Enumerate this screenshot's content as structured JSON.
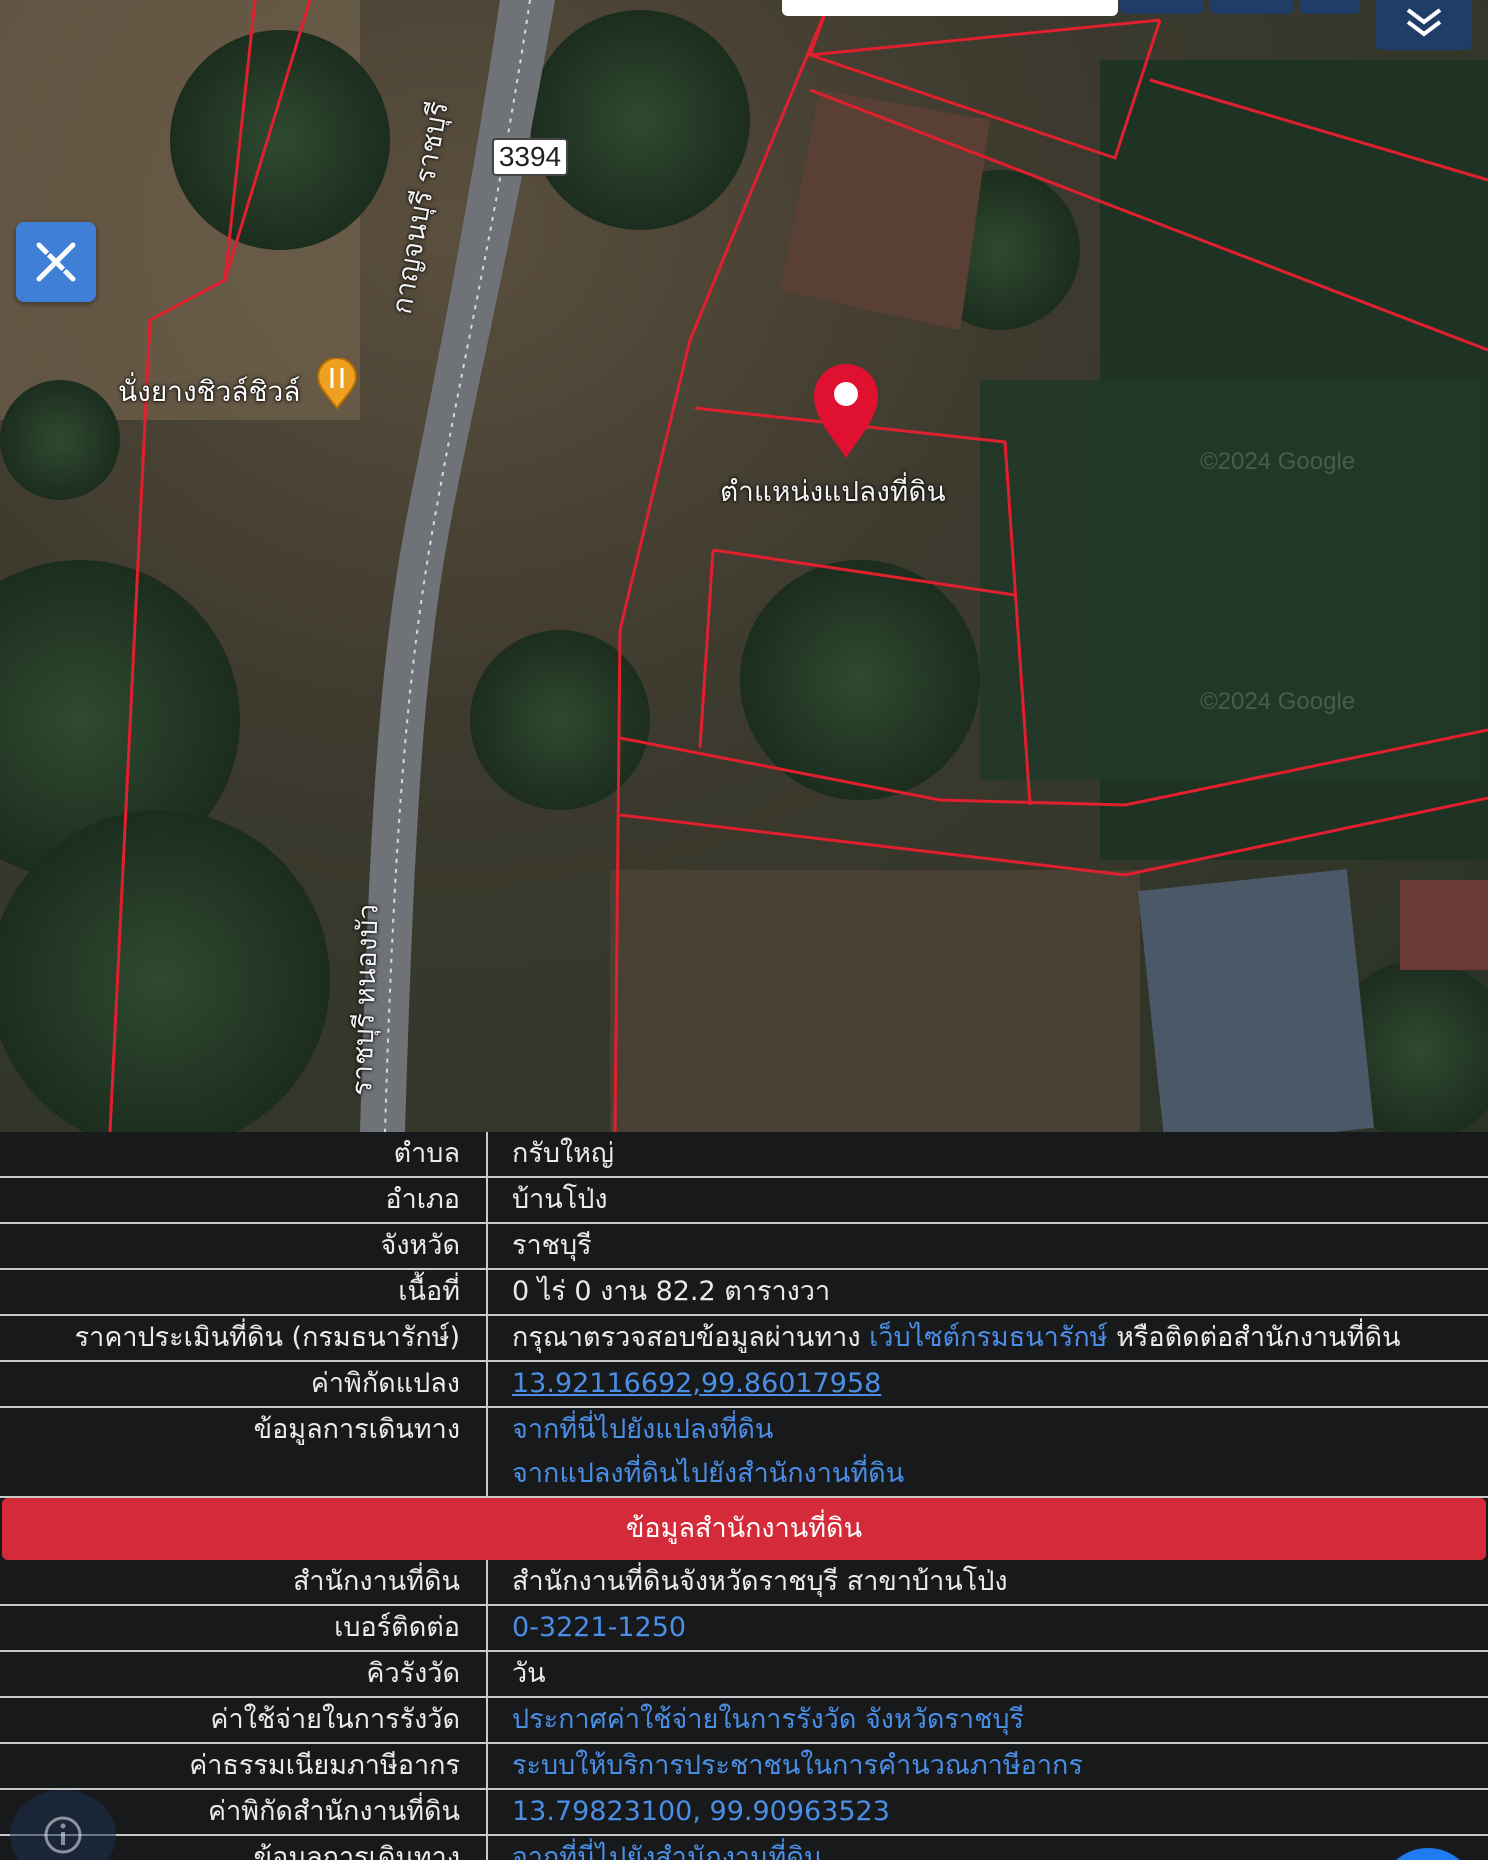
{
  "map": {
    "road_number": "3394",
    "road_name_top": "กาญจนบุรี ราชบุรี",
    "road_name_bottom": "ราชบุรี หนองบัว",
    "poi_name": "นั่งยางชิวล์ชิวล์",
    "pin_label": "ตำแหน่งแปลงที่ดิน",
    "watermark": "©2024 Google"
  },
  "icons": {
    "draw": "draw-ruler-pencil-icon",
    "layers": "layers-chevron-icon",
    "poi": "restaurant-icon",
    "pin": "map-pin-icon",
    "info": "info-icon"
  },
  "colors": {
    "parcel_line": "#e0202e",
    "section_header": "#d42a3a",
    "link": "#4a8ee6",
    "accent": "#3f7fd6"
  },
  "land": {
    "rows": [
      {
        "key": "ตำบล",
        "value": "กรับใหญ่"
      },
      {
        "key": "อำเภอ",
        "value": "บ้านโป่ง"
      },
      {
        "key": "จังหวัด",
        "value": "ราชบุรี"
      },
      {
        "key": "เนื้อที่",
        "value": "0 ไร่ 0 งาน 82.2 ตารางวา"
      }
    ],
    "price_key": "ราคาประเมินที่ดิน (กรมธนารักษ์)",
    "price_pre": "กรุณาตรวจสอบข้อมูลผ่านทาง",
    "price_link": "เว็บไซต์กรมธนารักษ์",
    "price_post": "หรือติดต่อสำนักงานที่ดิน",
    "coord_key": "ค่าพิกัดแปลง",
    "coord_value": "13.92116692,99.86017958",
    "travel_key": "ข้อมูลการเดินทาง",
    "travel_link_1": "จากที่นี่ไปยังแปลงที่ดิน",
    "travel_link_2": "จากแปลงที่ดินไปยังสำนักงานที่ดิน"
  },
  "office": {
    "section_title": "ข้อมูลสำนักงานที่ดิน",
    "office_key": "สำนักงานที่ดิน",
    "office_value": "สำนักงานที่ดินจังหวัดราชบุรี สาขาบ้านโป่ง",
    "phone_key": "เบอร์ติดต่อ",
    "phone_value": "0-3221-1250",
    "queue_key": "คิวรังวัด",
    "queue_value": "วัน",
    "cost_key": "ค่าใช้จ่ายในการรังวัด",
    "cost_value": "ประกาศค่าใช้จ่ายในการรังวัด จังหวัดราชบุรี",
    "fee_key": "ค่าธรรมเนียมภาษีอากร",
    "fee_value": "ระบบให้บริการประชาชนในการคำนวณภาษีอากร",
    "ocoord_key": "ค่าพิกัดสำนักงานที่ดิน",
    "ocoord_value": "13.79823100, 99.90963523",
    "otravel_key": "ข้อมูลการเดินทาง",
    "otravel_value": "จากที่นี่ไปยังสำนักงานที่ดิน"
  }
}
